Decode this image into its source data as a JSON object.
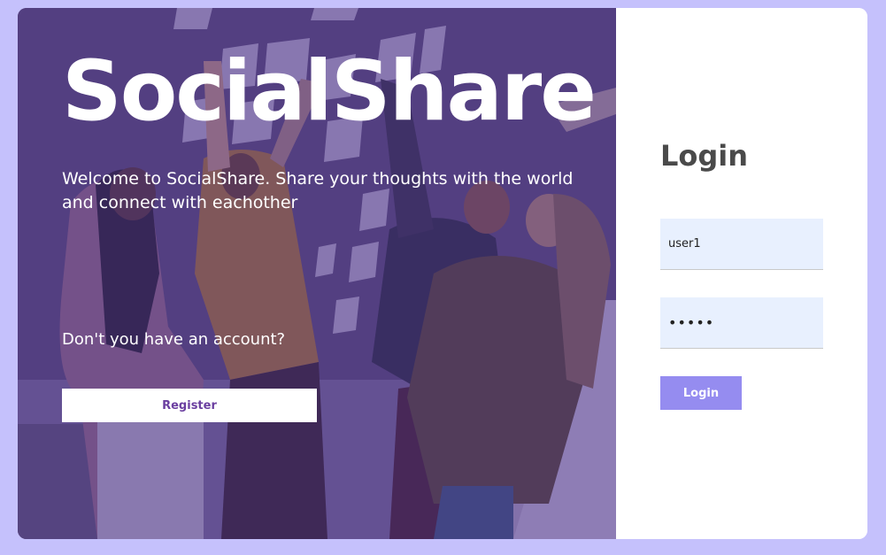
{
  "hero": {
    "brand": "SocialShare",
    "welcome": "Welcome to SocialShare. Share your thoughts with the world and connect with eachother",
    "question": "Don't you have an account?",
    "register_label": "Register"
  },
  "login": {
    "title": "Login",
    "username_value": "user1",
    "password_value": "•••••",
    "button_label": "Login"
  },
  "colors": {
    "page_background": "#c5c1fc",
    "overlay": "#5a3d96",
    "login_button": "#958cf0",
    "register_text": "#6b3fa0",
    "input_background": "#e8f0fe"
  }
}
